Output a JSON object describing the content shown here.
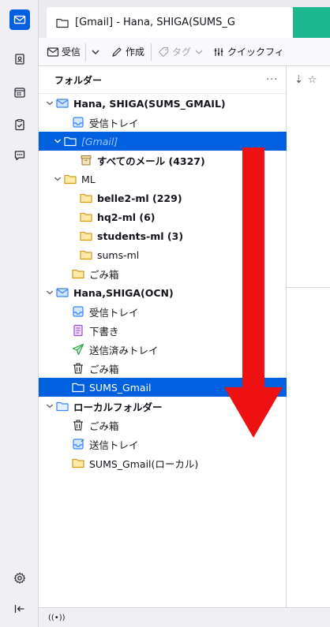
{
  "tab": {
    "title": "[Gmail] - Hana, SHIGA(SUMS_G"
  },
  "toolbar": {
    "get_messages": "受信",
    "write": "作成",
    "tag": "タグ",
    "quick_filter": "クイックフィ"
  },
  "folder_pane": {
    "title": "フォルダー",
    "more": "...",
    "folders": [
      {
        "label": "Hana, SHIGA(SUMS_GMAIL)",
        "icon": "account-mail-icon",
        "bold": true
      },
      {
        "label": "受信トレイ",
        "icon": "inbox-icon"
      },
      {
        "label": "[Gmail]",
        "icon": "folder-icon"
      },
      {
        "label": "すべてのメール (4327)",
        "icon": "archive-icon",
        "bold": true
      },
      {
        "label": "ML",
        "icon": "folder-icon"
      },
      {
        "label": "belle2-ml (229)",
        "icon": "folder-icon",
        "bold": true
      },
      {
        "label": "hq2-ml (6)",
        "icon": "folder-icon",
        "bold": true
      },
      {
        "label": "students-ml (3)",
        "icon": "folder-icon",
        "bold": true
      },
      {
        "label": "sums-ml",
        "icon": "folder-icon"
      },
      {
        "label": "ごみ箱",
        "icon": "folder-icon"
      },
      {
        "label": "Hana,SHIGA(OCN)",
        "icon": "account-mail-icon",
        "bold": true
      },
      {
        "label": "受信トレイ",
        "icon": "inbox-icon"
      },
      {
        "label": "下書き",
        "icon": "drafts-icon"
      },
      {
        "label": "送信済みトレイ",
        "icon": "sent-icon"
      },
      {
        "label": "ごみ箱",
        "icon": "trash-icon"
      },
      {
        "label": "SUMS_Gmail",
        "icon": "folder-icon"
      },
      {
        "label": "ローカルフォルダー",
        "icon": "local-folder-icon",
        "bold": true
      },
      {
        "label": "ごみ箱",
        "icon": "trash-icon"
      },
      {
        "label": "送信トレイ",
        "icon": "outbox-icon"
      },
      {
        "label": "SUMS_Gmail(ローカル)",
        "icon": "folder-icon"
      }
    ]
  },
  "status": {
    "indicator": "((•))"
  },
  "colors": {
    "accent": "#0060df",
    "folder": "#f5c542",
    "account": "#3b82f6",
    "sent": "#2e9e44",
    "drafts": "#9d4edd",
    "annotation_arrow": "#ee1111"
  }
}
